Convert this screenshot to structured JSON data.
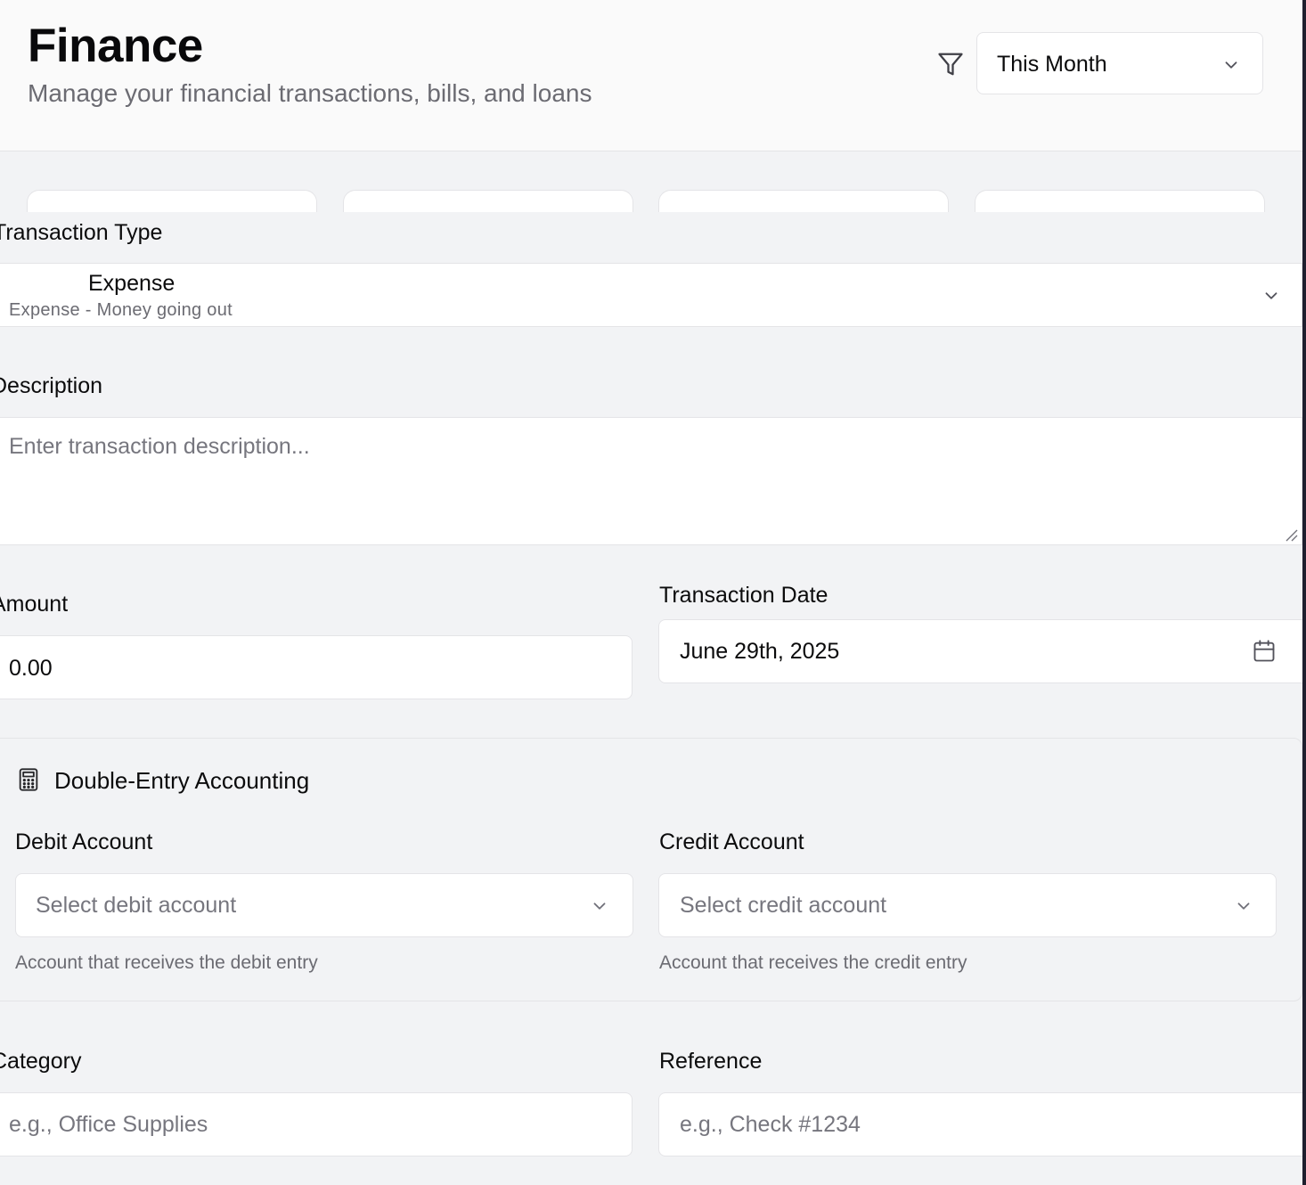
{
  "header": {
    "title": "Finance",
    "subtitle": "Manage your financial transactions, bills, and loans",
    "filter_icon": "filter-icon",
    "period": {
      "value": "This Month",
      "icon": "chevron-down-icon"
    }
  },
  "stat_cards_count": 4,
  "form": {
    "transaction_type": {
      "label": "Transaction Type",
      "value": "Expense",
      "description": "Expense - Money going out"
    },
    "description": {
      "label": "Description",
      "placeholder": "Enter transaction description..."
    },
    "amount": {
      "label": "Amount",
      "value": "0.00"
    },
    "transaction_date": {
      "label": "Transaction Date",
      "value": "June 29th, 2025",
      "icon": "calendar-icon"
    },
    "double_entry": {
      "title": "Double-Entry Accounting",
      "icon": "calculator-icon",
      "debit": {
        "label": "Debit Account",
        "placeholder": "Select debit account",
        "help": "Account that receives the debit entry"
      },
      "credit": {
        "label": "Credit Account",
        "placeholder": "Select credit account",
        "help": "Account that receives the credit entry"
      }
    },
    "category": {
      "label": "Category",
      "placeholder": "e.g., Office Supplies"
    },
    "reference": {
      "label": "Reference",
      "placeholder": "e.g., Check #1234"
    }
  }
}
